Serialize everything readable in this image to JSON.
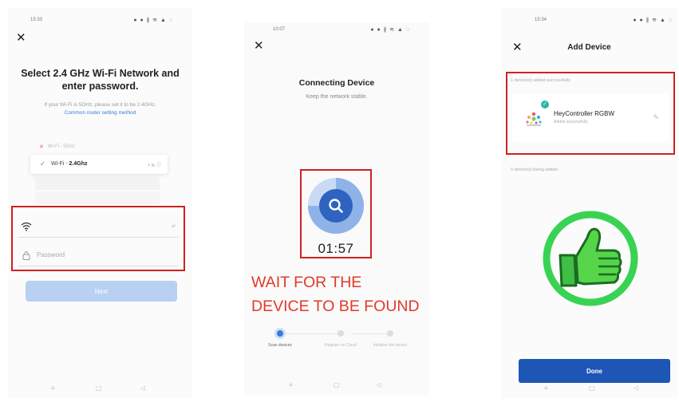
{
  "screen1": {
    "status_time": "15:33",
    "status_icons": "● ● ∦ ≋ ▲ ◌",
    "title": "Select 2.4 GHz Wi-Fi Network and enter password.",
    "subtitle": "If your Wi-Fi is 5GHz, please set it to be 2.4GHz.",
    "link": "Common router setting method",
    "wifi_5g": "Wi-Fi - 5Ghz",
    "wifi_24_prefix": "Wi-Fi - ",
    "wifi_24_band": "2.4Ghz",
    "password_placeholder": "Password",
    "next_label": "Next"
  },
  "screen2": {
    "status_time": "10:07",
    "status_icons": "● ● ∦ ≋ ▲ ◌",
    "title": "Connecting Device",
    "subtitle": "Keep the network stable.",
    "timer": "01:57",
    "steps": [
      {
        "label": "Scan devices"
      },
      {
        "label": "Register on Cloud"
      },
      {
        "label": "Initialize the device"
      }
    ],
    "active_step": 0
  },
  "annotation": {
    "line1": "WAIT FOR THE",
    "line2": "DEVICE TO BE FOUND"
  },
  "screen3": {
    "status_time": "15:34",
    "status_icons": "● ● ∦ ≋ ▲ ◌",
    "title": "Add Device",
    "added_caption": "1 device(s) added successfully",
    "device_name": "HeyController RGBW",
    "device_status": "Added successfully",
    "being_added": "0 device(s) being added",
    "done_label": "Done"
  },
  "colors": {
    "highlight": "#cc2222",
    "annotation": "#e03a2a",
    "accent_blue": "#3a7bd5",
    "done_blue": "#1e56b5",
    "thumb_green": "#39d353"
  },
  "navbar": {
    "menu": "≡",
    "home": "▢",
    "back": "◁"
  }
}
